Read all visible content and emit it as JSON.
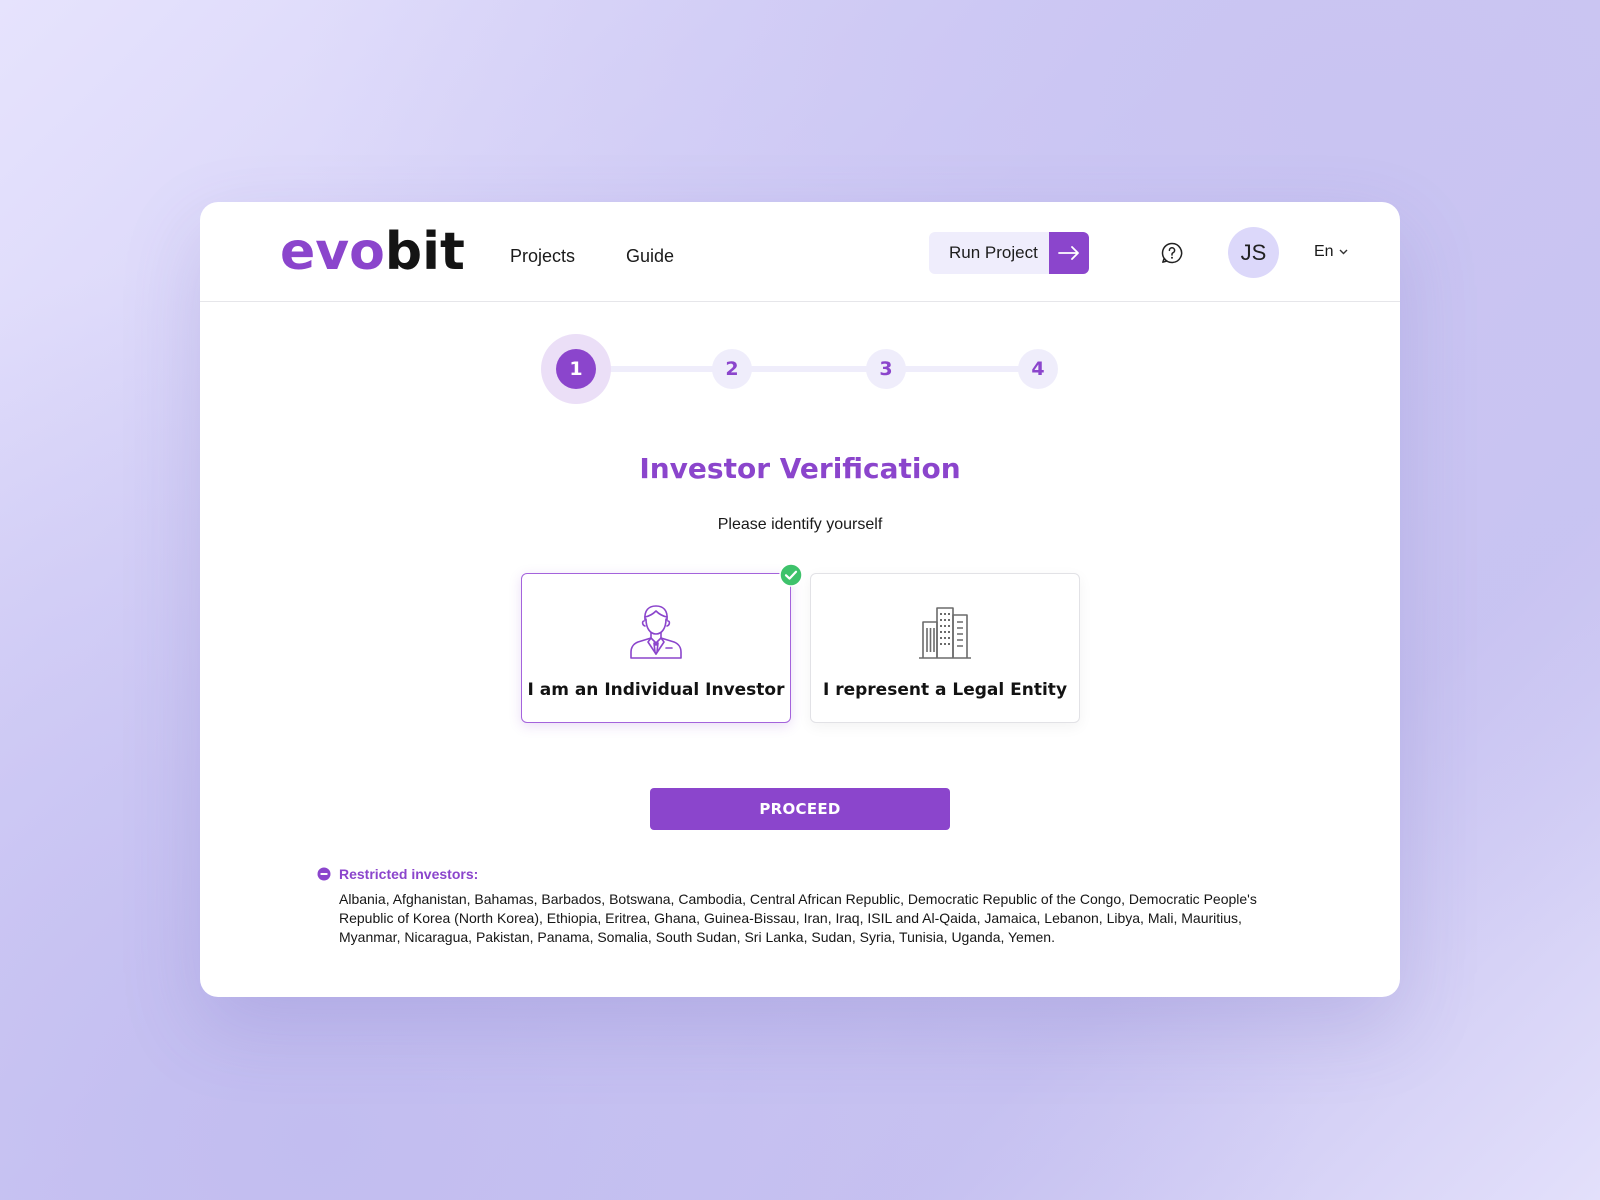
{
  "brand": {
    "logo_part1": "evo",
    "logo_part2": "bit",
    "accent": "#8b45cc"
  },
  "nav": {
    "items": [
      {
        "label": "Projects"
      },
      {
        "label": "Guide"
      }
    ]
  },
  "header": {
    "run_project_label": "Run Project",
    "run_project_icon": "arrow-right-icon",
    "help_icon": "question-bubble-icon",
    "avatar_initials": "JS",
    "language": "En",
    "language_icon": "chevron-down-icon"
  },
  "stepper": {
    "steps": [
      {
        "label": "1"
      },
      {
        "label": "2"
      },
      {
        "label": "3"
      },
      {
        "label": "4"
      }
    ],
    "current": 1
  },
  "page": {
    "title": "Investor Verification",
    "subtitle": "Please identify yourself"
  },
  "options": [
    {
      "label": "I am an Individual Investor",
      "icon": "person-suit-icon",
      "selected": true
    },
    {
      "label": "I represent a Legal Entity",
      "icon": "office-building-icon",
      "selected": false
    }
  ],
  "selected_badge_color": "#3ec26b",
  "proceed_label": "PROCEED",
  "restricted": {
    "label": "Restricted investors:",
    "icon": "minus-circle-icon",
    "countries": "Albania, Afghanistan, Bahamas, Barbados, Botswana, Cambodia, Central African Republic, Democratic Republic of the Congo, Democratic People's Republic of Korea (North Korea), Ethiopia, Eritrea, Ghana, Guinea-Bissau, Iran, Iraq, ISIL and Al-Qaida, Jamaica, Lebanon, Libya, Mali, Mauritius, Myanmar, Nicaragua, Pakistan, Panama, Somalia, South Sudan, Sri Lanka, Sudan, Syria, Tunisia, Uganda, Yemen."
  }
}
